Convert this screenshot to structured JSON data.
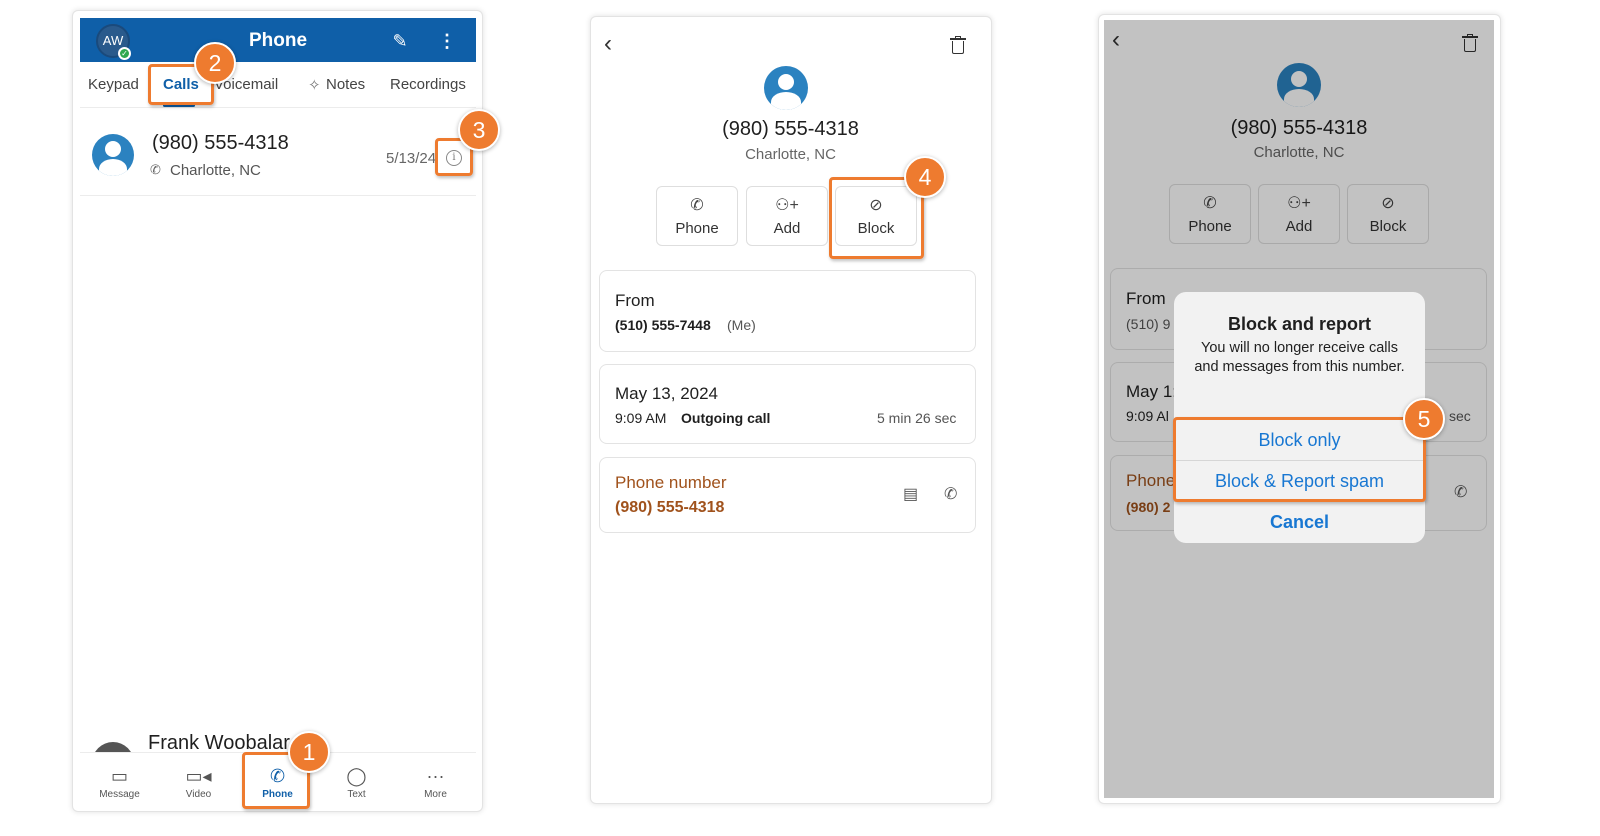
{
  "screen1": {
    "header": {
      "title": "Phone",
      "avatar_initials": "AW",
      "edit_icon": "pencil-icon",
      "more_icon": "vertical-ellipsis-icon"
    },
    "tabs": [
      "Keypad",
      "Calls",
      "Voicemail",
      "Notes",
      "Recordings"
    ],
    "active_tab": "Calls",
    "call": {
      "number": "(980) 555-4318",
      "location": "Charlotte, NC",
      "date": "5/13/24"
    },
    "next_call": {
      "name": "Frank Woobalar"
    },
    "nav": [
      {
        "label": "Message",
        "icon": "message-icon"
      },
      {
        "label": "Video",
        "icon": "video-icon"
      },
      {
        "label": "Phone",
        "icon": "phone-icon"
      },
      {
        "label": "Text",
        "icon": "chat-bubble-icon"
      },
      {
        "label": "More",
        "icon": "more-icon"
      }
    ]
  },
  "screen2": {
    "number": "(980) 555-4318",
    "location": "Charlotte, NC",
    "actions": [
      "Phone",
      "Add",
      "Block"
    ],
    "from": {
      "title": "From",
      "number": "(510) 555-7448",
      "suffix": "(Me)"
    },
    "call_detail": {
      "date": "May 13, 2024",
      "time": "9:09 AM",
      "type": "Outgoing call",
      "duration": "5 min 26 sec"
    },
    "phone_number": {
      "title": "Phone number",
      "value": "(980) 555-4318"
    }
  },
  "screen3": {
    "number": "(980) 555-4318",
    "location": "Charlotte, NC",
    "actions": [
      "Phone",
      "Add",
      "Block"
    ],
    "bg": {
      "from_title": "From",
      "from_number": "(510) 9",
      "date": "May 1:",
      "time": "9:09 Al",
      "duration": "sec",
      "phone_title": "Phone",
      "phone_value": "(980) 2"
    },
    "dialog": {
      "title": "Block and report",
      "message": "You will no longer receive calls and messages from this number.",
      "buttons": [
        "Block only",
        "Block & Report spam",
        "Cancel"
      ]
    }
  },
  "callouts": [
    "1",
    "2",
    "3",
    "4",
    "5"
  ],
  "colors": {
    "brand": "#0f5fa8",
    "callout": "#ee7b2f",
    "link": "#1877d2",
    "accent_text": "#a0521c"
  }
}
